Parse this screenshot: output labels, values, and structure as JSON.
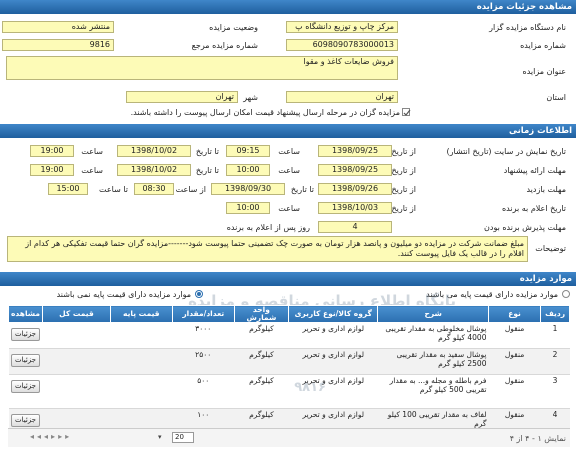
{
  "section1": {
    "title": "مشاهده جزئیات مزایده",
    "org_label": "نام دستگاه مزایده گزار",
    "org_value": "مرکز چاپ و توزیع دانشگاه پ",
    "status_label": "وضعیت مزایده",
    "status_value": "منتشر شده",
    "number_label": "شماره مزایده",
    "number_value": "6098090783000013",
    "ref_label": "شماره مزایده مرجع",
    "ref_value": "9816",
    "subject_label": "عنوان مزایده",
    "subject_value": "فروش ضایعات کاغذ و مقوا",
    "province_label": "استان",
    "province_value": "تهران",
    "city_label": "شهر",
    "city_value": "تهران",
    "check_text": "مزایده گزان در مرحله ارسال پیشنهاد قیمت امکان ارسال پیوست را داشته باشند."
  },
  "section2": {
    "title": "اطلاعات زمانی",
    "display_label": "تاریخ نمایش در سایت (تاریخ انتشار)",
    "from_date_label": "از تاریخ",
    "to_date_label": "تا تاریخ",
    "time_label": "ساعت",
    "display_from_date": "1398/09/25",
    "display_from_time": "09:15",
    "display_to_date": "1398/10/02",
    "display_to_time": "19:00",
    "offer_label": "مهلت ارائه پیشنهاد",
    "offer_from_date": "1398/09/25",
    "offer_from_time": "10:00",
    "offer_to_date": "1398/10/02",
    "offer_to_time": "19:00",
    "visit_label": "مهلت بازدید",
    "visit_from_date": "1398/09/26",
    "visit_to_date_label": "تا تاریخ",
    "visit_to_date": "1398/09/30",
    "visit_from_time_label": "از ساعت",
    "visit_from_time": "08:30",
    "visit_to_time_label": "تا ساعت",
    "visit_to_time": "15:00",
    "announce_label": "تاریخ اعلام به برنده",
    "announce_date": "1398/10/03",
    "announce_time": "10:00",
    "winner_label": "مهلت پذیرش برنده بودن",
    "winner_value": "4",
    "winner_suffix": "روز پس از اعلام به برنده",
    "desc_label": "توضیحات",
    "desc_value": "مبلغ ضمانت شرکت در مزایده دو میلیون و پانصد هزار تومان  به صورت چک تضمینی حتما پیوست شود-------مزایده گران حتما قیمت تفکیکی هر کدام از اقلام را در قالب یک فایل پیوست کنند."
  },
  "section3": {
    "title": "موارد مزایده",
    "radio1": "موارد مزایده دارای قیمت پایه می باشند",
    "radio2": "موارد مزایده دارای قیمت پایه نمی باشند",
    "watermark1": "پایگاه اطلاع رسانی مناقصه و مزایده",
    "watermark2": "۹۸۱۶",
    "headers": [
      "ردیف",
      "نوع",
      "شرح",
      "گروه کالا/نوع کاربری",
      "واحد شمارش",
      "تعداد/مقدار",
      "قیمت پایه",
      "قیمت کل",
      "مشاهده"
    ],
    "rows": [
      {
        "row": "1",
        "type": "منقول",
        "desc": "پوشال مخلوطی به مقدار تقریبی 4000 کیلو گرم",
        "group": "لوازم اداری و تحریر",
        "unit": "کیلوگرم",
        "qty": "۳۰۰۰",
        "base": "",
        "total": "",
        "view": "جزئیات"
      },
      {
        "row": "2",
        "type": "منقول",
        "desc": "پوشال سفید به مقدار تقریبی 2500 کیلو گرم",
        "group": "لوازم اداری و تحریر",
        "unit": "کیلوگرم",
        "qty": "۲۵۰۰",
        "base": "",
        "total": "",
        "view": "جزئیات"
      },
      {
        "row": "3",
        "type": "منقول",
        "desc": "فرم باطله و مجله و... به مقدار تقریبی 500 کیلو گرم",
        "group": "لوازم اداری و تحریر",
        "unit": "کیلوگرم",
        "qty": "۵۰۰",
        "base": "",
        "total": "",
        "view": "جزئیات"
      },
      {
        "row": "4",
        "type": "منقول",
        "desc": "لفاف به مقدار تقریبی 100 کیلو گرم",
        "group": "لوازم اداری و تحریر",
        "unit": "کیلوگرم",
        "qty": "۱۰۰",
        "base": "",
        "total": "",
        "view": "جزئیات"
      }
    ],
    "pager_info": "نمایش ۱ - ۴ از ۴",
    "page_size": "20"
  }
}
